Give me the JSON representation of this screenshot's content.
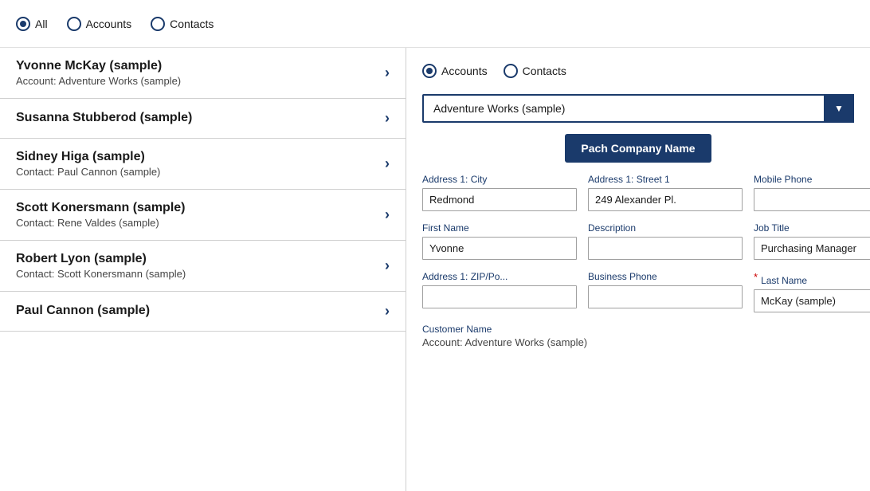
{
  "topFilter": {
    "options": [
      {
        "id": "all",
        "label": "All",
        "selected": true
      },
      {
        "id": "accounts",
        "label": "Accounts",
        "selected": false
      },
      {
        "id": "contacts",
        "label": "Contacts",
        "selected": false
      }
    ]
  },
  "listItems": [
    {
      "title": "Yvonne McKay (sample)",
      "subtitle": "Account: Adventure Works (sample)"
    },
    {
      "title": "Susanna Stubberod (sample)",
      "subtitle": ""
    },
    {
      "title": "Sidney Higa (sample)",
      "subtitle": "Contact: Paul Cannon (sample)"
    },
    {
      "title": "Scott Konersmann (sample)",
      "subtitle": "Contact: Rene Valdes (sample)"
    },
    {
      "title": "Robert Lyon (sample)",
      "subtitle": "Contact: Scott Konersmann (sample)"
    },
    {
      "title": "Paul Cannon (sample)",
      "subtitle": ""
    }
  ],
  "rightPanel": {
    "radioOptions": [
      {
        "id": "accounts",
        "label": "Accounts",
        "selected": true
      },
      {
        "id": "contacts",
        "label": "Contacts",
        "selected": false
      }
    ],
    "dropdown": {
      "value": "Adventure Works (sample)",
      "options": [
        "Adventure Works (sample)"
      ]
    },
    "patchButton": "Pach Company Name",
    "fields": [
      {
        "label": "Address 1: City",
        "value": "Redmond",
        "id": "address-city"
      },
      {
        "label": "Address 1: Street 1",
        "value": "249 Alexander Pl.",
        "id": "address-street"
      },
      {
        "label": "Mobile Phone",
        "value": "",
        "id": "mobile-phone"
      },
      {
        "label": "First Name",
        "value": "Yvonne",
        "id": "first-name"
      },
      {
        "label": "Description",
        "value": "",
        "id": "description"
      },
      {
        "label": "Job Title",
        "value": "Purchasing Manager",
        "id": "job-title"
      },
      {
        "label": "Address 1: ZIP/Po...",
        "value": "",
        "id": "address-zip"
      },
      {
        "label": "Business Phone",
        "value": "",
        "id": "business-phone"
      },
      {
        "label": "Last Name",
        "value": "McKay (sample)",
        "id": "last-name",
        "required": true
      }
    ],
    "customerName": {
      "label": "Customer Name",
      "value": "Account: Adventure Works (sample)"
    }
  }
}
